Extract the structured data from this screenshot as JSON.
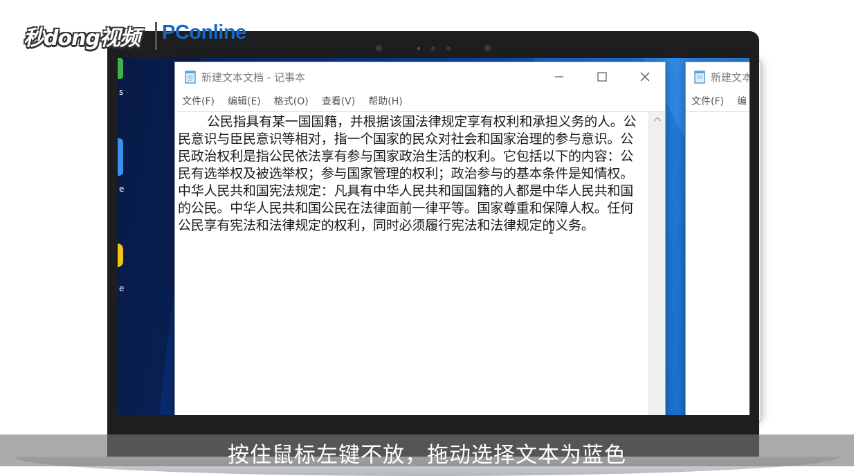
{
  "watermark": {
    "miaodong_logo": "秒dong视频",
    "pconline_logo": "PConline"
  },
  "desktop": {
    "icon_labels": [
      "s",
      "e",
      "e"
    ]
  },
  "notepad_main": {
    "title": "新建文本文档 - 记事本",
    "menus": [
      "文件(F)",
      "编辑(E)",
      "格式(O)",
      "查看(V)",
      "帮助(H)"
    ],
    "content": "公民指具有某一国国籍，并根据该国法律规定享有权利和承担义务的人。公民意识与臣民意识等相对，指一个国家的民众对社会和国家治理的参与意识。公民政治权利是指公民依法享有参与国家政治生活的权利。它包括以下的内容：公民有选举权及被选举权；参与国家管理的权利；政治参与的基本条件是知情权。中华人民共和国宪法规定：凡具有中华人民共和国国籍的人都是中华人民共和国的公民。中华人民共和国公民在法律面前一律平等。国家尊重和保障人权。任何公民享有宪法和法律规定的权利，同时必须履行宪法和法律规定的义务。"
  },
  "notepad_second": {
    "title": "新建文本",
    "menus": [
      "文件(F)",
      "编"
    ]
  },
  "caption": {
    "text": "按住鼠标左键不放，拖动选择文本为蓝色"
  },
  "colors": {
    "desktop_dark": "#0a1f55",
    "desktop_light": "#1b76d2",
    "pconline_blue": "#1867c7",
    "bezel": "#1e1e20"
  }
}
